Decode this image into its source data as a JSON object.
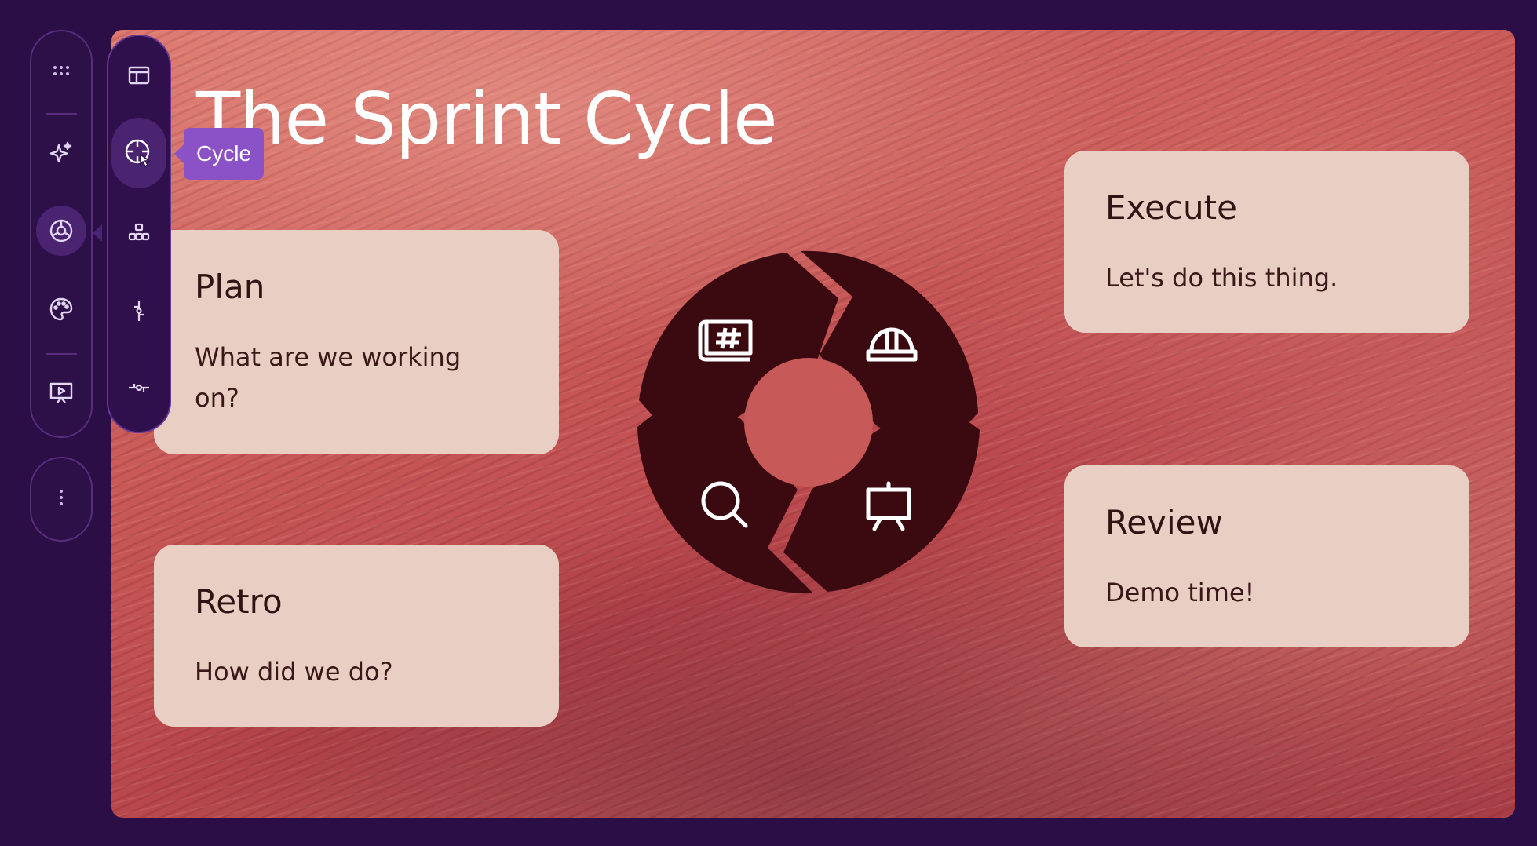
{
  "slide": {
    "title": "The Sprint Cycle",
    "cards": {
      "plan": {
        "title": "Plan",
        "body": "What are we working on?"
      },
      "retro": {
        "title": "Retro",
        "body": "How did we do?"
      },
      "execute": {
        "title": "Execute",
        "body": "Let's do this thing."
      },
      "review": {
        "title": "Review",
        "body": "Demo time!"
      }
    },
    "cycle": {
      "segments": [
        {
          "stage": "plan",
          "icon": "blueprint-icon"
        },
        {
          "stage": "execute",
          "icon": "hard-hat-icon"
        },
        {
          "stage": "review",
          "icon": "presentation-board-icon"
        },
        {
          "stage": "retro",
          "icon": "magnifier-icon"
        }
      ],
      "color": "#3a0a10"
    }
  },
  "toolbar": {
    "main": [
      {
        "name": "drag-handle-icon"
      },
      {
        "name": "sparkle-icon"
      },
      {
        "name": "cycle-diagram-icon",
        "active": true
      },
      {
        "name": "palette-icon"
      },
      {
        "name": "present-icon"
      }
    ],
    "more": "more-options-icon"
  },
  "submenu": {
    "items": [
      "layout-icon",
      "cycle-icon",
      "hierarchy-icon",
      "timeline-vertical-icon",
      "timeline-horizontal-icon"
    ],
    "hovered": "Cycle"
  },
  "tooltip": {
    "label": "Cycle"
  },
  "colors": {
    "background": "#2a0e45",
    "card": "#e9cec4",
    "tooltip": "#8b52c8",
    "title": "#ffffff"
  }
}
